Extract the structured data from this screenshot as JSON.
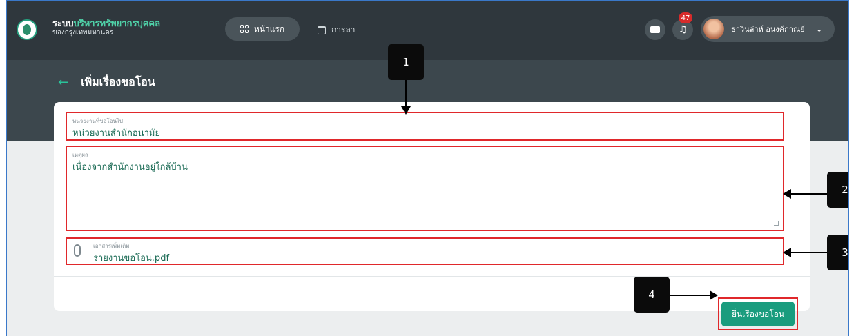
{
  "header": {
    "brand_title_1": "ระบบ",
    "brand_title_2": "บริหารทรัพยากรบุคคล",
    "brand_subtitle": "ของกรุงเทพมหานคร",
    "nav_home": "หน้าแรก",
    "nav_leave": "การลา",
    "notification_count": "47",
    "user_name": "ธาวินล่าห์ อนงค์กาณย์"
  },
  "page": {
    "title": "เพิ่มเรื่องขอโอน",
    "back_icon": "arrow-left-icon"
  },
  "form": {
    "agency_label": "หน่วยงานที่ขอโอนไป",
    "agency_value": "หน่วยงานสำนักอนามัย",
    "reason_label": "เหตุผล",
    "reason_value": "เนื่องจากสำนักงานอยู่ใกล้บ้าน",
    "attachment_label": "เอกสารเพิ่มเติม",
    "attachment_value": "รายงานขอโอน.pdf",
    "submit_label": "ยื่นเรื่องขอโอน"
  },
  "callouts": [
    "1",
    "2",
    "3",
    "4"
  ],
  "colors": {
    "topbar": "#2f373d",
    "accent": "#1a9c7e",
    "highlight": "#e0282b"
  }
}
